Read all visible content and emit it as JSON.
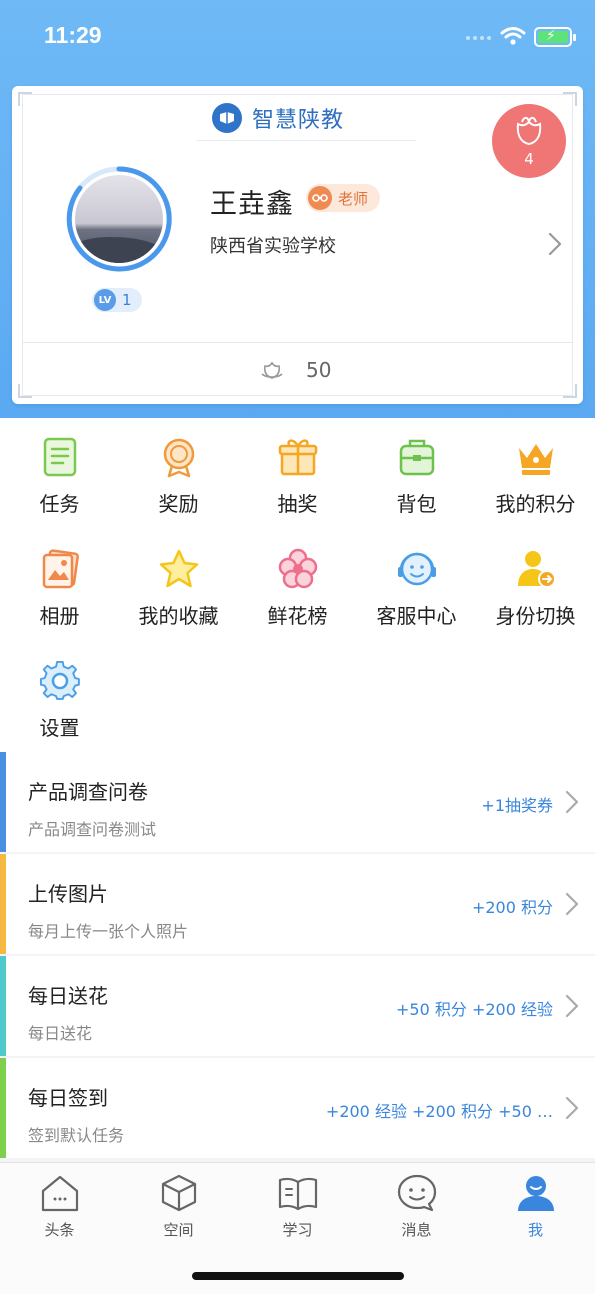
{
  "status_bar": {
    "time": "11:29"
  },
  "card": {
    "brand_name": "智慧陕教",
    "flower_count": "4",
    "user_name": "王垚鑫",
    "role": "老师",
    "school": "陕西省实验学校",
    "level": "1",
    "level_prefix": "LV",
    "flowers_received": "50"
  },
  "grid": [
    {
      "label": "任务",
      "icon": "task-icon"
    },
    {
      "label": "奖励",
      "icon": "medal-icon"
    },
    {
      "label": "抽奖",
      "icon": "gift-icon"
    },
    {
      "label": "背包",
      "icon": "backpack-icon"
    },
    {
      "label": "我的积分",
      "icon": "crown-icon"
    },
    {
      "label": "相册",
      "icon": "album-icon"
    },
    {
      "label": "我的收藏",
      "icon": "star-icon"
    },
    {
      "label": "鲜花榜",
      "icon": "flower-icon"
    },
    {
      "label": "客服中心",
      "icon": "headset-icon"
    },
    {
      "label": "身份切换",
      "icon": "switch-user-icon"
    },
    {
      "label": "设置",
      "icon": "gear-icon"
    }
  ],
  "tasks": [
    {
      "title": "产品调查问卷",
      "desc": "产品调查问卷测试",
      "reward": "+1抽奖券",
      "color": "#4a90e2"
    },
    {
      "title": "上传图片",
      "desc": "每月上传一张个人照片",
      "reward": "+200 积分",
      "color": "#f5b942"
    },
    {
      "title": "每日送花",
      "desc": "每日送花",
      "reward": "+50 积分 +200 经验",
      "color": "#4fc9c9"
    },
    {
      "title": "每日签到",
      "desc": "签到默认任务",
      "reward": "+200 经验 +200 积分 +50 …",
      "color": "#7ed04b"
    }
  ],
  "tabs": [
    {
      "label": "头条",
      "icon": "home-icon"
    },
    {
      "label": "空间",
      "icon": "cube-icon"
    },
    {
      "label": "学习",
      "icon": "book-icon"
    },
    {
      "label": "消息",
      "icon": "chat-icon"
    },
    {
      "label": "我",
      "icon": "profile-icon",
      "active": true
    }
  ],
  "colors": {
    "header": "#5aa9f2",
    "accent": "#3a86dc",
    "flower_badge": "#f07676"
  }
}
